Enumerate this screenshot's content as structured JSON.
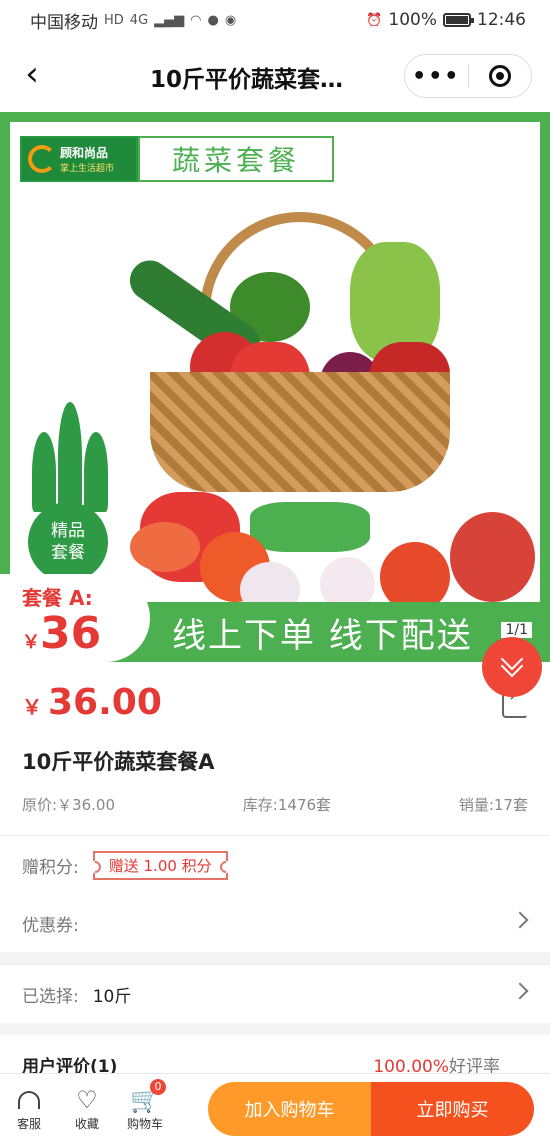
{
  "status_bar": {
    "carrier": "中国移动",
    "network": "4G",
    "battery": "100%",
    "time": "12:46"
  },
  "nav": {
    "title": "10斤平价蔬菜套…"
  },
  "banner": {
    "logo_name": "顾和尚品",
    "logo_tagline": "掌上生活超市",
    "title": "蔬菜套餐",
    "badge_line1": "精品",
    "badge_line2": "套餐",
    "package_label": "套餐 A:",
    "package_yen": "￥",
    "package_price": "36",
    "slogan": "线上下单 线下配送",
    "pager": "1/1"
  },
  "product": {
    "price_symbol": "￥",
    "price": "36.00",
    "name": "10斤平价蔬菜套餐A",
    "original_price": "原价:￥36.00",
    "stock": "库存:1476套",
    "sales": "销量:17套"
  },
  "rows": {
    "points_label": "赠积分:",
    "points_value": "赠送 1.00 积分",
    "coupon_label": "优惠券:",
    "selected_label": "已选择:",
    "selected_value": "10斤",
    "reviews_label": "用户评价(1)",
    "reviews_rate": "100.00%",
    "reviews_rate_label": "好评率"
  },
  "bottom_bar": {
    "service_label": "客服",
    "favorite_label": "收藏",
    "cart_label": "购物车",
    "cart_count": "0",
    "add_to_cart": "加入购物车",
    "buy_now": "立即购买"
  },
  "colors": {
    "brand_green": "#4caf50",
    "price_red": "#e53935",
    "cart_orange": "#ff9a2a",
    "buy_orange": "#f4511e"
  }
}
